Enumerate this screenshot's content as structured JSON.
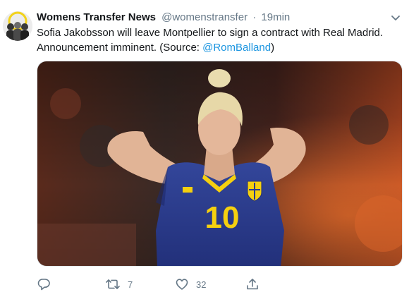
{
  "tweet": {
    "author_name": "Womens Transfer News",
    "handle": "@womenstransfer",
    "separator": "·",
    "time": "19min",
    "text_line1": "Sofia Jakobsson will leave Montpellier to sign a contract with Real Madrid.",
    "text_line2_prefix": "Announcement imminent. (Source: ",
    "mention": "@RomBalland",
    "text_line2_suffix": ")",
    "jersey_number": "10"
  },
  "actions": {
    "retweets": "7",
    "likes": "32"
  },
  "colors": {
    "link": "#1b95e0",
    "muted": "#657786",
    "jersey": "#2a3a8f",
    "jersey_number": "#f5d00f",
    "hair": "#e7d8a8",
    "skin": "#e4b79a"
  },
  "icons": [
    "avatar",
    "chevron-down-icon",
    "reply-icon",
    "retweet-icon",
    "like-icon",
    "share-icon"
  ]
}
